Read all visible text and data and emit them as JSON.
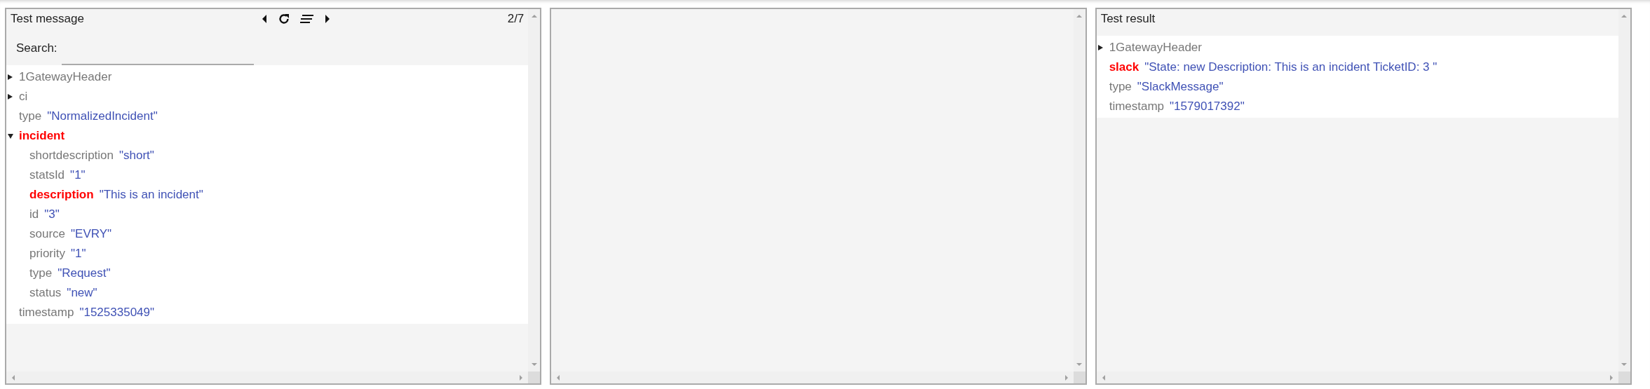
{
  "panels": [
    {
      "kind": "tree",
      "title": "Test message",
      "toolbar": {
        "counter": "2/7"
      },
      "search": {
        "label": "Search:"
      },
      "tree": [
        {
          "kind": "object",
          "key": "1GatewayHeader",
          "expanded": false,
          "highlighted": false
        },
        {
          "kind": "object",
          "key": "ci",
          "expanded": false,
          "highlighted": false
        },
        {
          "kind": "field",
          "key": "type",
          "value": "\"NormalizedIncident\"",
          "highlighted": false
        },
        {
          "kind": "object",
          "key": "incident",
          "expanded": true,
          "highlighted": true,
          "children": [
            {
              "kind": "field",
              "key": "shortdescription",
              "value": "\"short\"",
              "highlighted": false
            },
            {
              "kind": "field",
              "key": "statsId",
              "value": "\"1\"",
              "highlighted": false
            },
            {
              "kind": "field",
              "key": "description",
              "value": "\"This is an incident\"",
              "highlighted": true
            },
            {
              "kind": "field",
              "key": "id",
              "value": "\"3\"",
              "highlighted": false
            },
            {
              "kind": "field",
              "key": "source",
              "value": "\"EVRY\"",
              "highlighted": false
            },
            {
              "kind": "field",
              "key": "priority",
              "value": "\"1\"",
              "highlighted": false
            },
            {
              "kind": "field",
              "key": "type",
              "value": "\"Request\"",
              "highlighted": false
            },
            {
              "kind": "field",
              "key": "status",
              "value": "\"new\"",
              "highlighted": false
            }
          ]
        },
        {
          "kind": "field",
          "key": "timestamp",
          "value": "\"1525335049\"",
          "highlighted": false
        }
      ]
    },
    {
      "kind": "blank"
    },
    {
      "kind": "tree",
      "title": "Test result",
      "tree": [
        {
          "kind": "object",
          "key": "1GatewayHeader",
          "expanded": false,
          "highlighted": false
        },
        {
          "kind": "field",
          "key": "slack",
          "value": "\"State: new Description: This is an incident TicketID: 3 \"",
          "highlighted": true
        },
        {
          "kind": "field",
          "key": "type",
          "value": "\"SlackMessage\"",
          "highlighted": false
        },
        {
          "kind": "field",
          "key": "timestamp",
          "value": "\"1579017392\"",
          "highlighted": false
        }
      ]
    }
  ]
}
